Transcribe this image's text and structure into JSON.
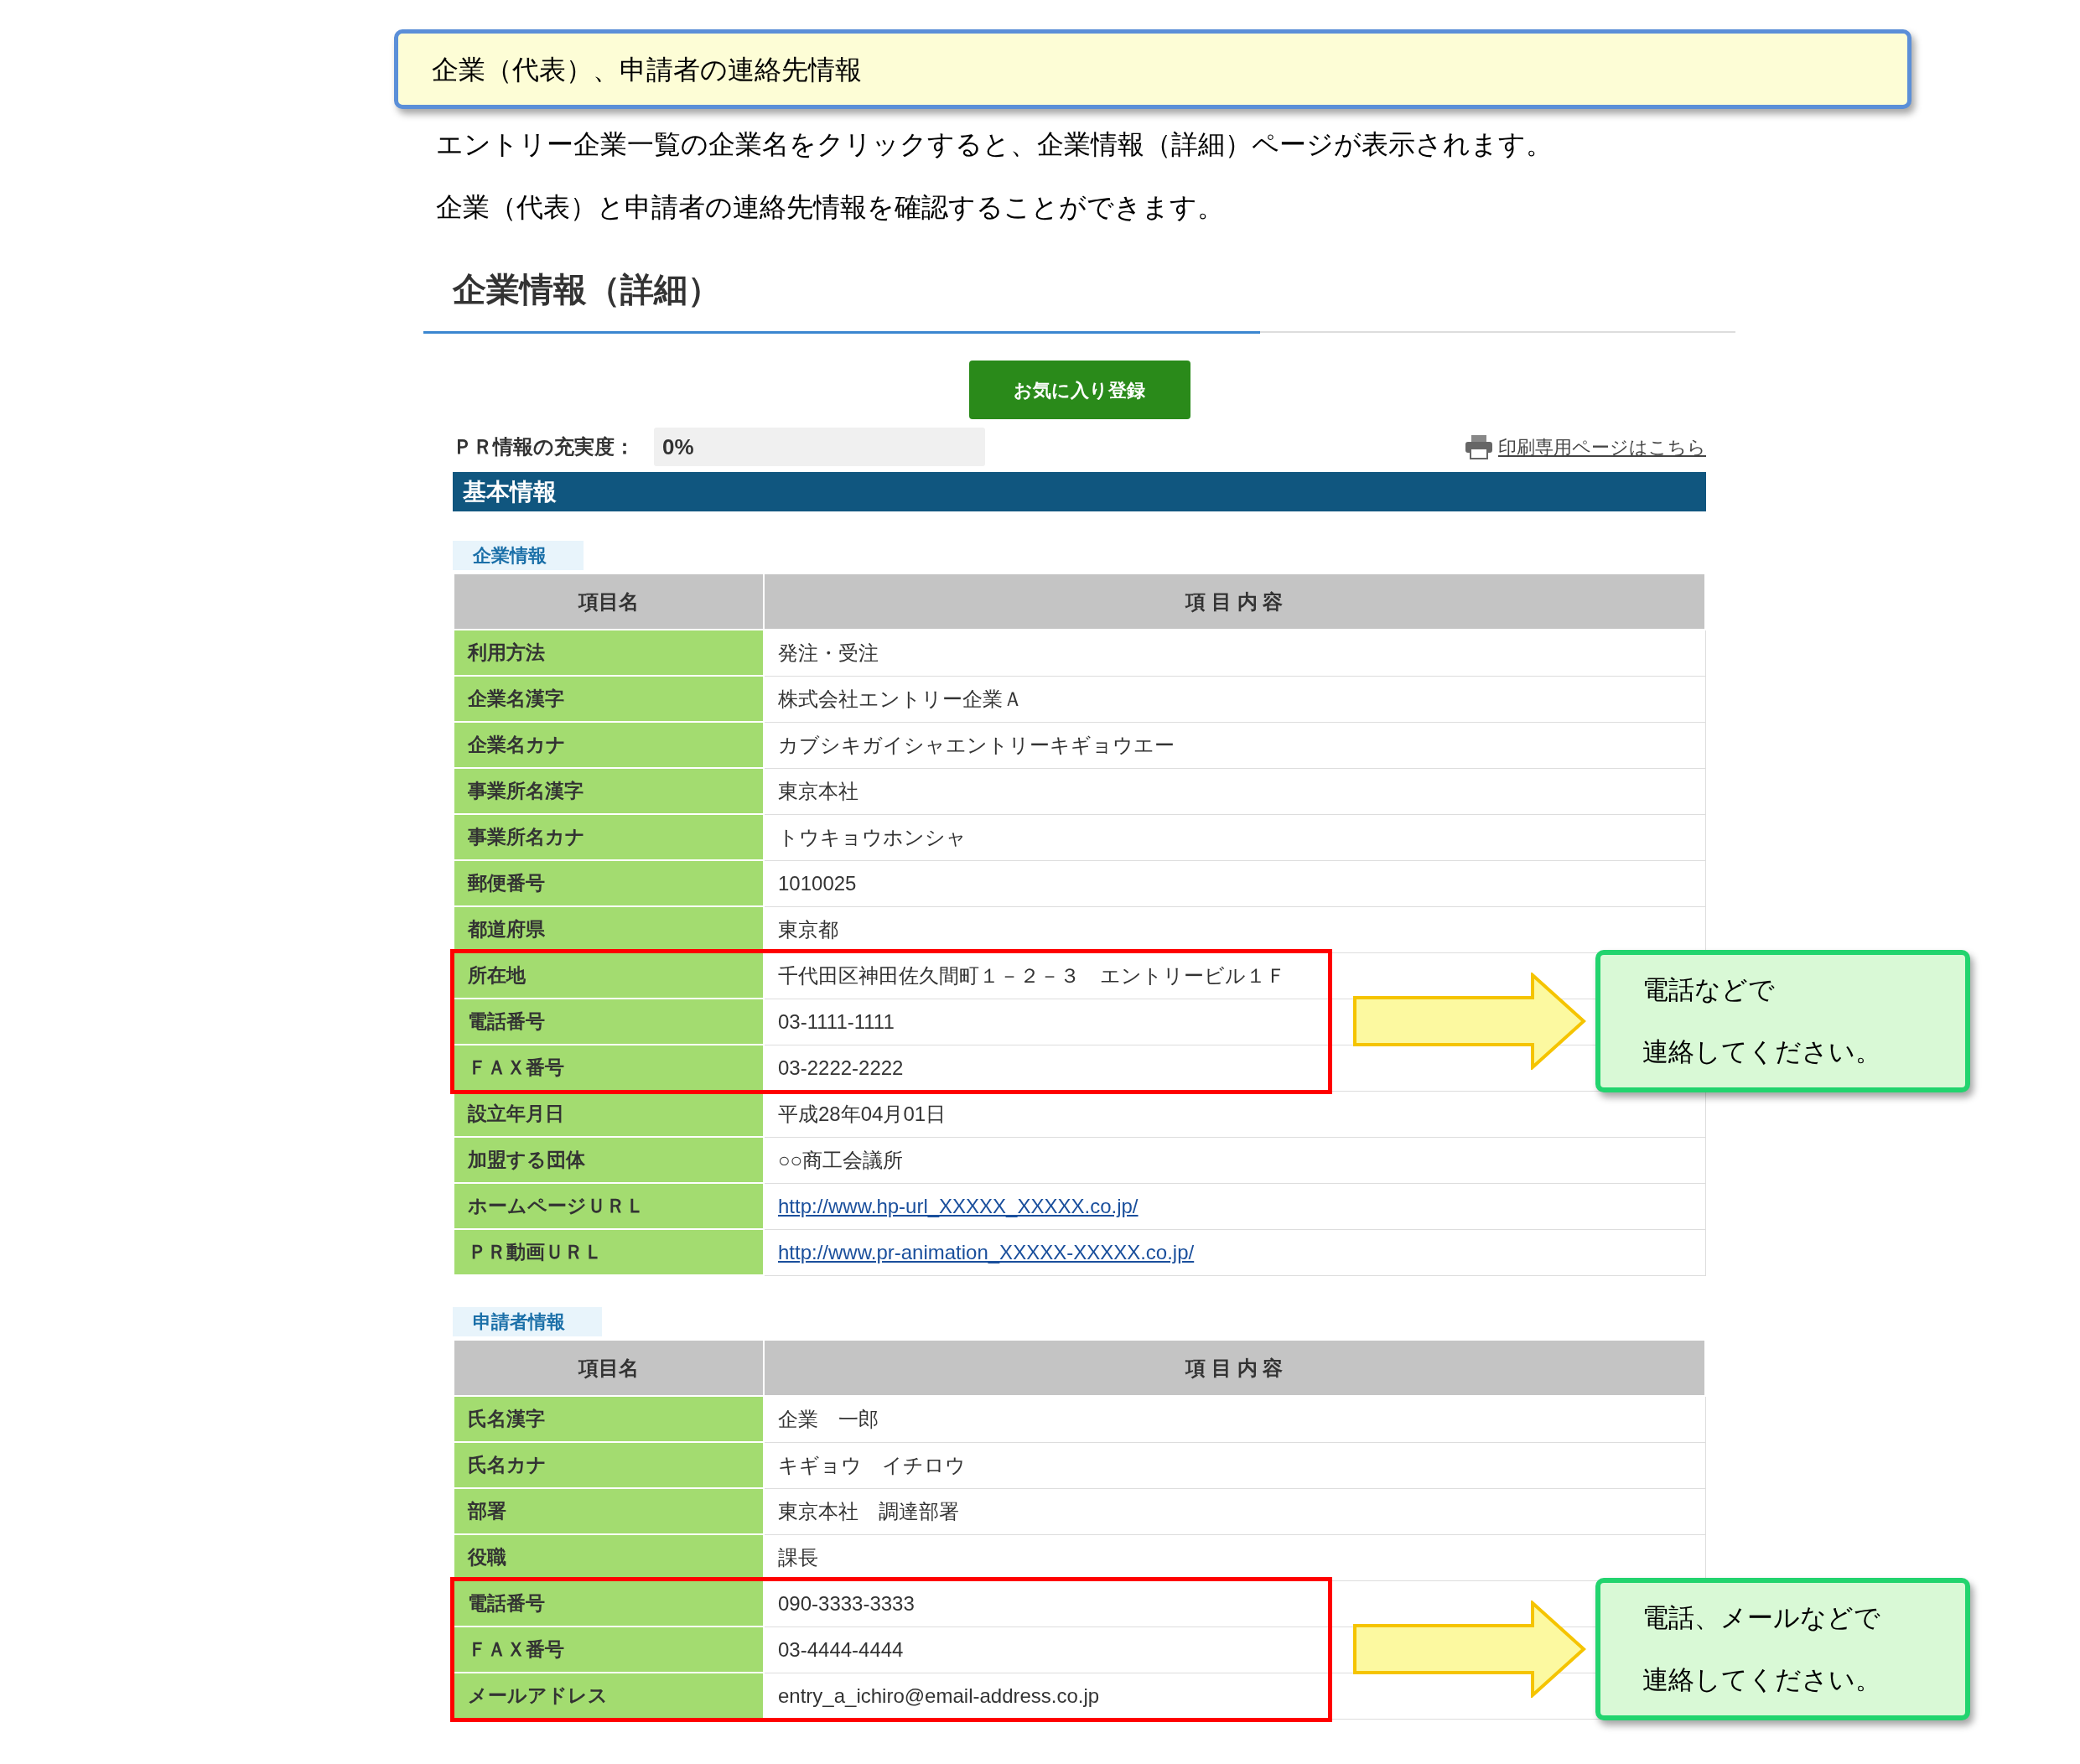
{
  "banner": {
    "text": "企業（代表）、申請者の連絡先情報"
  },
  "intro": [
    "エントリー企業一覧の企業名をクリックすると、企業情報（詳細）ページが表示されます。",
    "企業（代表）と申請者の連絡先情報を確認することができます。"
  ],
  "heading": "企業情報（詳細）",
  "favorite_button": "お気に入り登録",
  "pr_completeness": {
    "label": "ＰＲ情報の充実度：",
    "value": "0%"
  },
  "print_link": "印刷専用ページはこちら",
  "section_bar": "基本情報",
  "tables": [
    {
      "tab": "企業情報",
      "columns": [
        "項目名",
        "項 目 内 容"
      ],
      "rows": [
        {
          "label": "利用方法",
          "value": "発注・受注",
          "kind": "text",
          "highlighted": false
        },
        {
          "label": "企業名漢字",
          "value": "株式会社エントリー企業Ａ",
          "kind": "text",
          "highlighted": false
        },
        {
          "label": "企業名カナ",
          "value": "カブシキガイシャエントリーキギョウエー",
          "kind": "text",
          "highlighted": false
        },
        {
          "label": "事業所名漢字",
          "value": "東京本社",
          "kind": "text",
          "highlighted": false
        },
        {
          "label": "事業所名カナ",
          "value": "トウキョウホンシャ",
          "kind": "text",
          "highlighted": false
        },
        {
          "label": "郵便番号",
          "value": "1010025",
          "kind": "text",
          "highlighted": false
        },
        {
          "label": "都道府県",
          "value": "東京都",
          "kind": "text",
          "highlighted": false
        },
        {
          "label": "所在地",
          "value": "千代田区神田佐久間町１－２－３　エントリービル１Ｆ",
          "kind": "text",
          "highlighted": true
        },
        {
          "label": "電話番号",
          "value": "03-1111-1111",
          "kind": "text",
          "highlighted": true
        },
        {
          "label": "ＦＡＸ番号",
          "value": "03-2222-2222",
          "kind": "text",
          "highlighted": true
        },
        {
          "label": "設立年月日",
          "value": "平成28年04月01日",
          "kind": "text",
          "highlighted": false
        },
        {
          "label": "加盟する団体",
          "value": "○○商工会議所",
          "kind": "text",
          "highlighted": false
        },
        {
          "label": "ホームページＵＲＬ",
          "value": "http://www.hp-url_XXXXX_XXXXX.co.jp/",
          "kind": "link",
          "highlighted": false
        },
        {
          "label": "ＰＲ動画ＵＲＬ",
          "value": "http://www.pr-animation_XXXXX-XXXXX.co.jp/",
          "kind": "link",
          "highlighted": false
        }
      ],
      "note": {
        "lines": [
          "電話などで",
          "連絡してください。"
        ]
      }
    },
    {
      "tab": "申請者情報",
      "columns": [
        "項目名",
        "項 目 内 容"
      ],
      "rows": [
        {
          "label": "氏名漢字",
          "value": "企業　一郎",
          "kind": "text",
          "highlighted": false
        },
        {
          "label": "氏名カナ",
          "value": "キギョウ　イチロウ",
          "kind": "text",
          "highlighted": false
        },
        {
          "label": "部署",
          "value": "東京本社　調達部署",
          "kind": "text",
          "highlighted": false
        },
        {
          "label": "役職",
          "value": "課長",
          "kind": "text",
          "highlighted": false
        },
        {
          "label": "電話番号",
          "value": "090-3333-3333",
          "kind": "text",
          "highlighted": true
        },
        {
          "label": "ＦＡＸ番号",
          "value": "03-4444-4444",
          "kind": "text",
          "highlighted": true
        },
        {
          "label": "メールアドレス",
          "value": "entry_a_ichiro@email-address.co.jp",
          "kind": "text",
          "highlighted": true
        }
      ],
      "note": {
        "lines": [
          "電話、メールなどで",
          "連絡してください。"
        ]
      }
    }
  ]
}
